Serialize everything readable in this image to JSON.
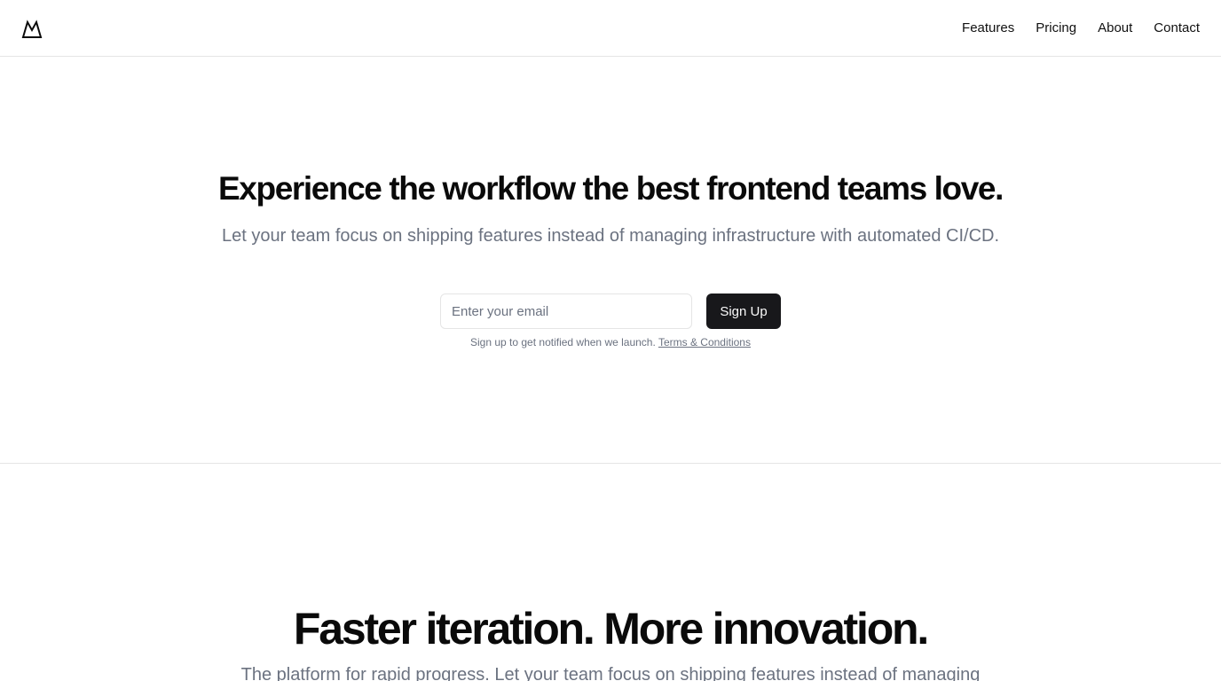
{
  "header": {
    "logo_icon": "mountain-icon",
    "nav": [
      {
        "label": "Features"
      },
      {
        "label": "Pricing"
      },
      {
        "label": "About"
      },
      {
        "label": "Contact"
      }
    ]
  },
  "hero": {
    "title": "Experience the workflow the best frontend teams love.",
    "subtitle": "Let your team focus on shipping features instead of managing infrastructure with automated CI/CD.",
    "email_placeholder": "Enter your email",
    "email_value": "",
    "signup_label": "Sign Up",
    "note_text": "Sign up to get notified when we launch.",
    "terms_label": "Terms & Conditions"
  },
  "features_section": {
    "title": "Faster iteration. More innovation.",
    "subtitle": "The platform for rapid progress. Let your team focus on shipping features instead of managing"
  },
  "colors": {
    "text_primary": "#0a0a0a",
    "text_muted": "#6b7280",
    "button_bg": "#18181b",
    "button_text": "#fafafa",
    "border": "#e5e5e5"
  }
}
